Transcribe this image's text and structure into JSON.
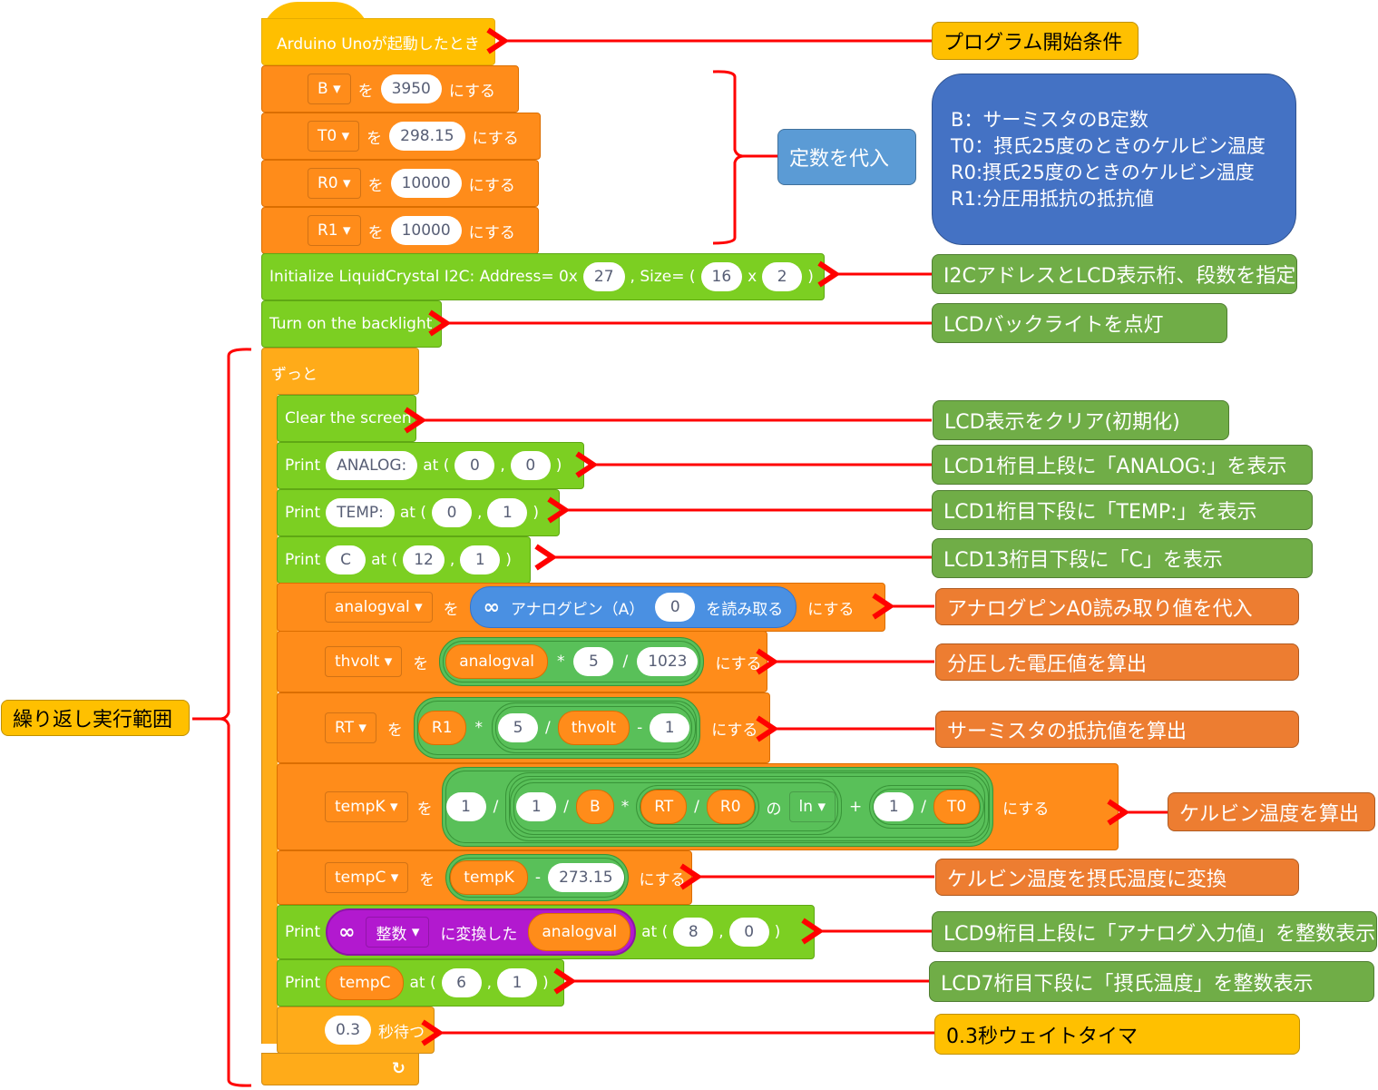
{
  "blocks": {
    "hat": "Arduino Unoが起動したとき",
    "setConsts": [
      {
        "var": "B",
        "value": "3950",
        "suffix": "にする",
        "wo": "を"
      },
      {
        "var": "T0",
        "value": "298.15",
        "suffix": "にする",
        "wo": "を"
      },
      {
        "var": "R0",
        "value": "10000",
        "suffix": "にする",
        "wo": "を"
      },
      {
        "var": "R1",
        "value": "10000",
        "suffix": "にする",
        "wo": "を"
      }
    ],
    "init": {
      "label": "Initialize LiquidCrystal I2C: Address= 0x",
      "address": "27",
      "size_label": ", Size= (",
      "cols": "16",
      "x": "x",
      "rows": "2",
      "close": ")"
    },
    "backlight": "Turn on the backlight",
    "forever": "ずっと",
    "clear": "Clear the screen",
    "print1": {
      "label": "Print",
      "text": "ANALOG:",
      "at": "at (",
      "col": "0",
      "comma": ",",
      "row": "0",
      "close": ")"
    },
    "print2": {
      "label": "Print",
      "text": "TEMP:",
      "at": "at (",
      "col": "0",
      "comma": ",",
      "row": "1",
      "close": ")"
    },
    "print3": {
      "label": "Print",
      "text": "C",
      "at": "at (",
      "col": "12",
      "comma": ",",
      "row": "1",
      "close": ")"
    },
    "analog": {
      "var": "analogval",
      "wo": "を",
      "pin_label": "アナログピン（A）",
      "pin": "0",
      "read": "を読み取る",
      "suffix": "にする"
    },
    "thvolt": {
      "var": "thvolt",
      "wo": "を",
      "a": "analogval",
      "op1": "*",
      "b": "5",
      "op2": "/",
      "c": "1023",
      "suffix": "にする"
    },
    "rt": {
      "var": "RT",
      "wo": "を",
      "a": "R1",
      "op1": "*",
      "b": "5",
      "op2": "/",
      "c": "thvolt",
      "op3": "-",
      "d": "1",
      "suffix": "にする"
    },
    "tempk": {
      "var": "tempK",
      "wo": "を",
      "one": "1",
      "div": "/",
      "one2": "1",
      "div2": "/",
      "B": "B",
      "mul": "*",
      "RT": "RT",
      "div3": "/",
      "R0": "R0",
      "no": "の",
      "fn": "ln",
      "plus": "+",
      "one3": "1",
      "div4": "/",
      "T0": "T0",
      "suffix": "にする"
    },
    "tempc": {
      "var": "tempC",
      "wo": "を",
      "a": "tempK",
      "op": "-",
      "b": "273.15",
      "suffix": "にする"
    },
    "print4": {
      "label": "Print",
      "type": "整数",
      "conv": "に変換した",
      "val": "analogval",
      "at": "at (",
      "col": "8",
      "comma": ",",
      "row": "0",
      "close": ")"
    },
    "print5": {
      "label": "Print",
      "val": "tempC",
      "at": "at (",
      "col": "6",
      "comma": ",",
      "row": "1",
      "close": ")"
    },
    "wait": {
      "value": "0.3",
      "label": "秒待つ"
    },
    "loop_icon": "↻"
  },
  "notes": {
    "start": "プログラム開始条件",
    "consts": "定数を代入",
    "legend": [
      "B：サーミスタのB定数",
      "T0：摂氏25度のときのケルビン温度",
      "R0:摂氏25度のときのケルビン温度",
      "R1:分圧用抵抗の抵抗値"
    ],
    "i2c": "I2CアドレスとLCD表示桁、段数を指定",
    "backlight": "LCDバックライトを点灯",
    "clear": "LCD表示をクリア(初期化)",
    "print1": "LCD1桁目上段に「ANALOG:」を表示",
    "print2": "LCD1桁目下段に「TEMP:」を表示",
    "print3": "LCD13桁目下段に「C」を表示",
    "analog": "アナログピンA0読み取り値を代入",
    "thvolt": "分圧した電圧値を算出",
    "rt": "サーミスタの抵抗値を算出",
    "tempk": "ケルビン温度を算出",
    "tempc": "ケルビン温度を摂氏温度に変換",
    "print4": "LCD9桁目上段に「アナログ入力値」を整数表示",
    "print5": "LCD7桁目下段に「摂氏温度」を整数表示",
    "wait": "0.3秒ウェイトタイマ",
    "loop": "繰り返し実行範囲"
  },
  "colors": {
    "arrow": "#ff0000",
    "hat": "#ffbf00",
    "variable": "#ff8c1a",
    "lcd": "#7ccf22",
    "control": "#ffab19",
    "operator": "#59c059",
    "arduino": "#4a90e2",
    "convert": "#b219cf"
  }
}
